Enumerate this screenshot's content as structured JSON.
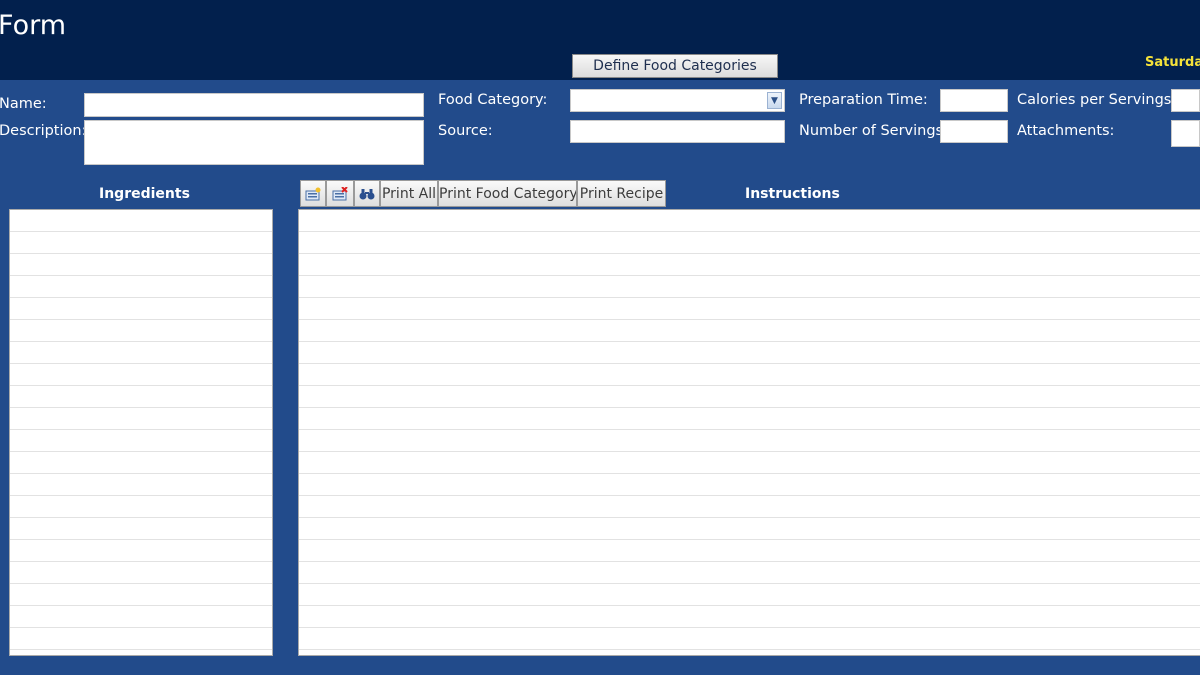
{
  "header": {
    "title": "Form",
    "define_button": "Define Food Categories",
    "date": "Saturday"
  },
  "form": {
    "name_label": "Name:",
    "description_label": "Description:",
    "food_category_label": "Food Category:",
    "source_label": "Source:",
    "prep_time_label": "Preparation Time:",
    "servings_label": "Number of Servings:",
    "calories_label": "Calories per Servings:",
    "attachments_label": "Attachments:",
    "name_value": "",
    "description_value": "",
    "food_category_value": "",
    "source_value": "",
    "prep_time_value": "",
    "servings_value": "",
    "calories_value": "",
    "attachments_value": ""
  },
  "sections": {
    "ingredients": "Ingredients",
    "instructions": "Instructions"
  },
  "toolbar": {
    "new_icon": "new-record-icon",
    "delete_icon": "delete-record-icon",
    "find_icon": "binoculars-icon",
    "print_all": "Print All",
    "print_food_category": "Print Food Category",
    "print_recipe": "Print Recipe"
  },
  "colors": {
    "background": "#224b8b",
    "header": "#02204d",
    "date_text": "#f5e23a"
  }
}
